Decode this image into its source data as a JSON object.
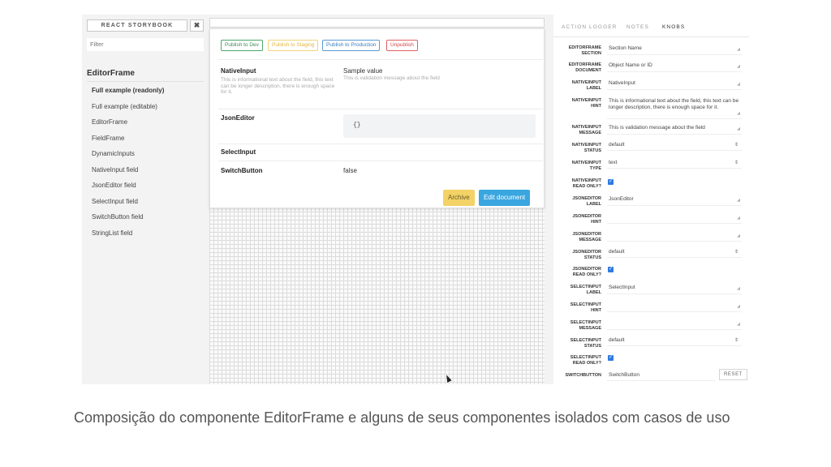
{
  "sidebar": {
    "title": "REACT STORYBOOK",
    "close_icon": "✖",
    "filter_placeholder": "Filter",
    "section": "EditorFrame",
    "items": [
      {
        "label": "Full example (readonly)",
        "active": true
      },
      {
        "label": "Full example (editable)"
      },
      {
        "label": "EditorFrame"
      },
      {
        "label": "FieldFrame"
      },
      {
        "label": "DynamicInputs"
      },
      {
        "label": "NativeInput field"
      },
      {
        "label": "JsonEditor field"
      },
      {
        "label": "SelectInput field"
      },
      {
        "label": "SwitchButton field"
      },
      {
        "label": "StringList field"
      }
    ]
  },
  "preview": {
    "publish_buttons": {
      "dev": "Publish to Dev",
      "staging": "Publish to Staging",
      "production": "Publish to Production",
      "unpublish": "Unpublish"
    },
    "fields": {
      "native_label": "NativeInput",
      "native_hint": "This is informational text about the field, this text can be longer description, there is enough space for it.",
      "native_value": "Sample value",
      "native_message": "This is validation message about the field",
      "json_label": "JsonEditor",
      "json_value": "{}",
      "select_label": "SelectInput",
      "switch_label": "SwitchButton",
      "switch_value": "false"
    },
    "archive_button": "Archive",
    "edit_button": "Edit document"
  },
  "panel": {
    "tabs": [
      "ACTION LOGGER",
      "NOTES",
      "KNOBS"
    ],
    "reset_button": "RESET",
    "knobs": {
      "ef_section_l1": "EDITORFRAME",
      "ef_section_l2": "SECTION",
      "ef_section_v": "Section Name",
      "ef_document_l1": "EDITORFRAME",
      "ef_document_l2": "DOCUMENT",
      "ef_document_v": "Object Name or ID",
      "ni_label_l1": "NATIVEINPUT",
      "ni_label_l2": "LABEL",
      "ni_label_v": "NativeInput",
      "ni_hint_l1": "NATIVEINPUT",
      "ni_hint_l2": "HINT",
      "ni_hint_v": "This is informational text about the field, this text can be longer description, there is enough space for it.",
      "ni_message_l1": "NATIVEINPUT",
      "ni_message_l2": "MESSAGE",
      "ni_message_v": "This is validation message about the field",
      "ni_status_l1": "NATIVEINPUT",
      "ni_status_l2": "STATUS",
      "ni_status_v": "default",
      "ni_type_l1": "NATIVEINPUT",
      "ni_type_l2": "TYPE",
      "ni_type_v": "text",
      "ni_ro_l1": "NATIVEINPUT",
      "ni_ro_l2": "READ ONLY?",
      "je_label_l1": "JSONEDITOR",
      "je_label_l2": "LABEL",
      "je_label_v": "JsonEditor",
      "je_hint_l1": "JSONEDITOR",
      "je_hint_l2": "HINT",
      "je_message_l1": "JSONEDITOR",
      "je_message_l2": "MESSAGE",
      "je_status_l1": "JSONEDITOR",
      "je_status_l2": "STATUS",
      "je_status_v": "default",
      "je_ro_l1": "JSONEDITOR",
      "je_ro_l2": "READ ONLY?",
      "si_label_l1": "SELECTINPUT",
      "si_label_l2": "LABEL",
      "si_label_v": "SelectInput",
      "si_hint_l1": "SELECTINPUT",
      "si_hint_l2": "HINT",
      "si_message_l1": "SELECTINPUT",
      "si_message_l2": "MESSAGE",
      "si_status_l1": "SELECTINPUT",
      "si_status_l2": "STATUS",
      "si_status_v": "default",
      "si_ro_l1": "SELECTINPUT",
      "si_ro_l2": "READ ONLY?",
      "sb_label_l1": "SWITCHBUTTON",
      "sb_label_v": "SwitchButton"
    }
  },
  "caption": "Composição do componente EditorFrame e alguns de seus componentes isolados com casos de uso"
}
